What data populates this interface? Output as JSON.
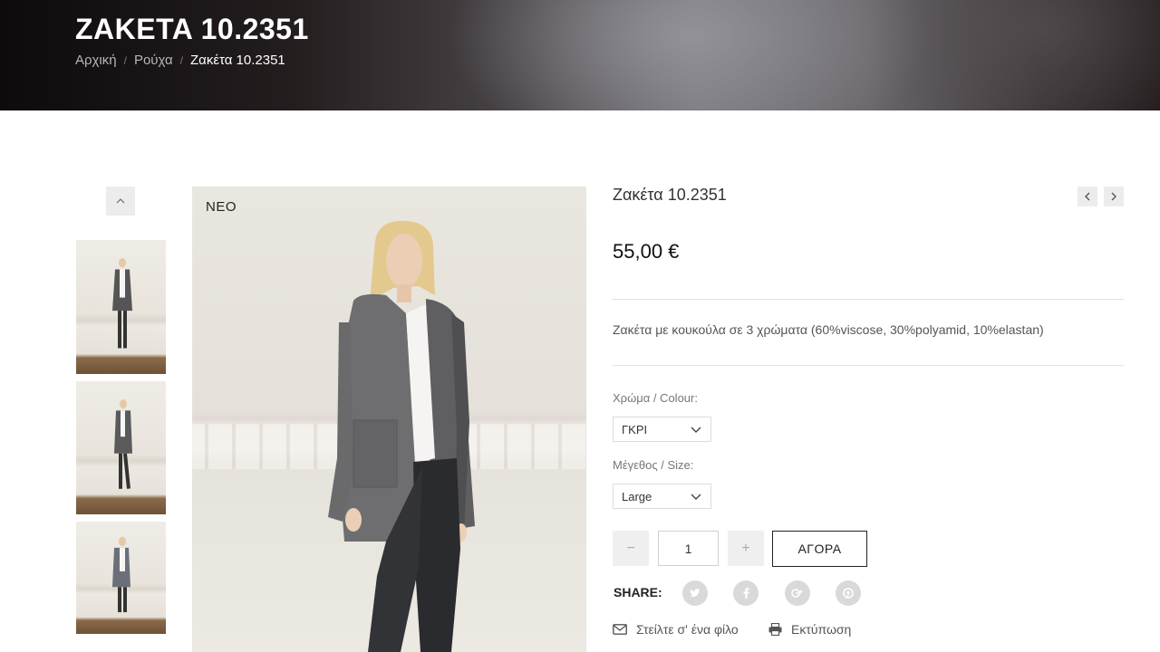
{
  "header": {
    "title": "ZAKETA 10.2351",
    "breadcrumb": [
      {
        "label": "Αρχική"
      },
      {
        "label": "Ρούχα"
      },
      {
        "label": "Ζακέτα 10.2351"
      }
    ]
  },
  "gallery": {
    "badge": "ΝΕΟ",
    "thumbnails": [
      "thumbnail-1",
      "thumbnail-2",
      "thumbnail-3"
    ]
  },
  "product": {
    "name": "Ζακέτα 10.2351",
    "price": "55,00 €",
    "description": "Ζακέτα με κουκούλα σε 3 χρώματα (60%viscose, 30%polyamid, 10%elastan)",
    "colour_label": "Χρώμα / Colour:",
    "colour_value": "ΓΚΡΙ",
    "size_label": "Μέγεθος / Size:",
    "size_value": "Large",
    "quantity": "1",
    "minus": "−",
    "plus": "+",
    "buy_label": "ΑΓΟΡΑ",
    "share_label": "SHARE:",
    "send_friend": "Στείλτε σ' ένα φίλο",
    "print": "Εκτύπωση"
  },
  "icons": {
    "prev": "chevron-left-icon",
    "next": "chevron-right-icon",
    "share": [
      "twitter-icon",
      "facebook-icon",
      "google-plus-icon",
      "pinterest-icon"
    ]
  },
  "colors": {
    "accent": "#222222",
    "muted": "#d9d9d9"
  }
}
